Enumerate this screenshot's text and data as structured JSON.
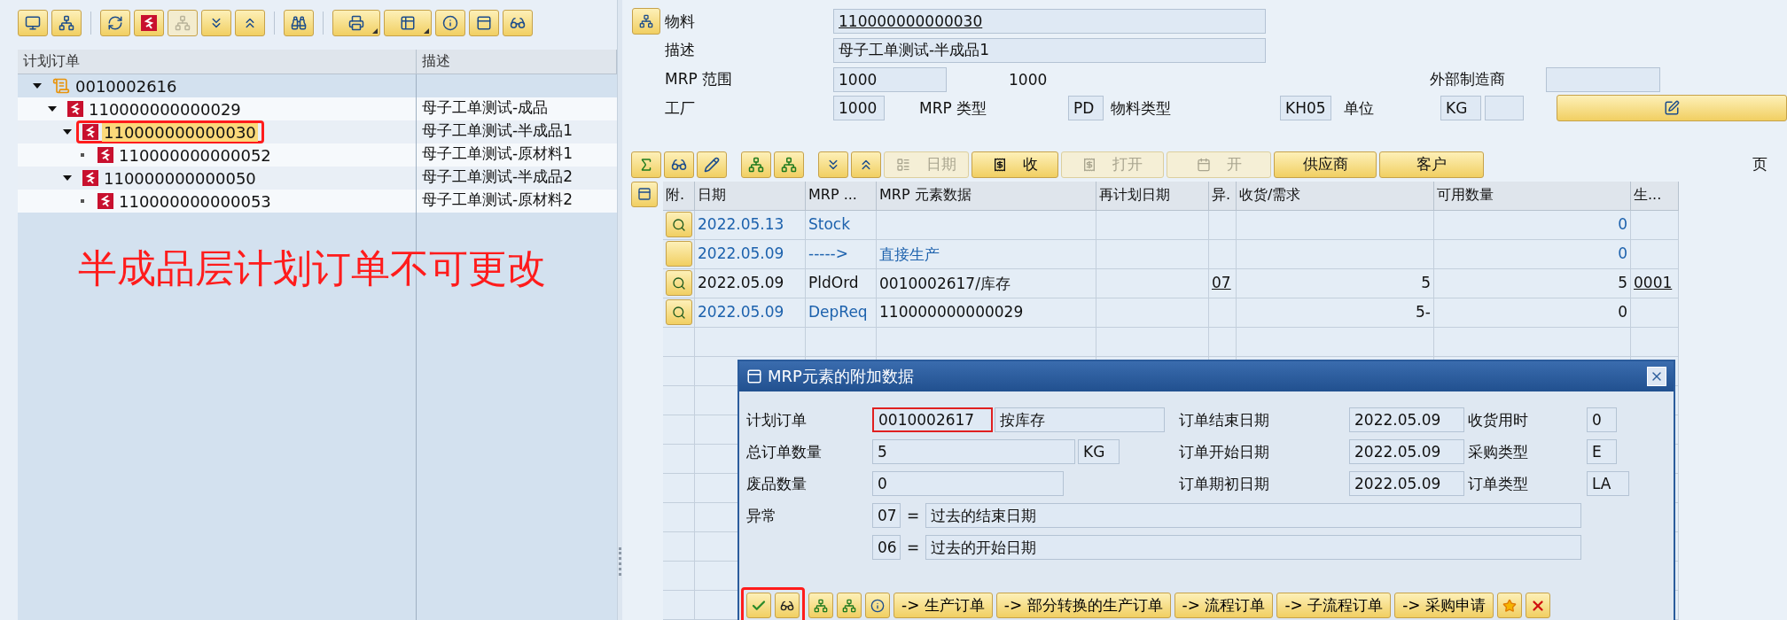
{
  "tree": {
    "columns": [
      "计划订单",
      "描述"
    ],
    "nodes": [
      {
        "label": "0010002616",
        "kind": "collective",
        "expanded": true,
        "selected": false,
        "marked": false,
        "children": [
          {
            "label": "110000000000029",
            "description": "母子工单测试-成品",
            "kind": "order",
            "expanded": true,
            "selected": false,
            "marked": false,
            "children": [
              {
                "label": "110000000000030",
                "description": "母子工单测试-半成品1",
                "kind": "order",
                "expanded": true,
                "selected": true,
                "marked": true,
                "children": [
                  {
                    "label": "110000000000052",
                    "description": "母子工单测试-原材料1",
                    "kind": "order",
                    "selected": false,
                    "marked": false
                  }
                ]
              },
              {
                "label": "110000000000050",
                "description": "母子工单测试-半成品2",
                "kind": "order",
                "expanded": true,
                "selected": false,
                "marked": false,
                "children": [
                  {
                    "label": "110000000000053",
                    "description": "母子工单测试-原材料2",
                    "kind": "order",
                    "selected": false,
                    "marked": false
                  }
                ]
              }
            ]
          }
        ]
      }
    ]
  },
  "annotation": {
    "text": "半成品层计划订单不可更改"
  },
  "header": {
    "material": {
      "label": "物料",
      "value": "110000000000030"
    },
    "description": {
      "label": "描述",
      "value": "母子工单测试-半成品1"
    },
    "mrp_area": {
      "label": "MRP 范围",
      "value": "1000",
      "text": "1000"
    },
    "manufacturer": {
      "label": "外部制造商"
    },
    "plant": {
      "label": "工厂",
      "value": "1000"
    },
    "mrp_type": {
      "label": "MRP 类型",
      "value": "PD"
    },
    "material_type": {
      "label": "物料类型",
      "value": "KH05"
    },
    "unit": {
      "label": "单位",
      "value": "KG"
    }
  },
  "toolbar": {
    "buttons": [
      {
        "label": "日期",
        "kind": "date",
        "disabled": true
      },
      {
        "label": "收",
        "kind": "receipt",
        "disabled": false
      },
      {
        "label": "打开",
        "kind": "receipt",
        "disabled": true
      },
      {
        "label": "开",
        "kind": "calendar",
        "disabled": true
      },
      {
        "label": "供应商",
        "kind": "text",
        "disabled": false
      },
      {
        "label": "客户",
        "kind": "text",
        "disabled": false
      }
    ],
    "page_label": "页"
  },
  "table": {
    "columns": [
      {
        "label": "附.",
        "kind": "icon"
      },
      {
        "label": "日期",
        "kind": "text"
      },
      {
        "label": "MRP ...",
        "kind": "text"
      },
      {
        "label": "MRP 元素数据",
        "kind": "text"
      },
      {
        "label": "再计划日期",
        "kind": "text"
      },
      {
        "label": "异.",
        "kind": "link"
      },
      {
        "label": "收货/需求",
        "kind": "number"
      },
      {
        "label": "可用数量",
        "kind": "number"
      },
      {
        "label": "生...",
        "kind": "link"
      }
    ],
    "rows": [
      {
        "kind": "info",
        "has_details": true,
        "cells": [
          "",
          "2022.05.13",
          "Stock",
          "",
          "",
          "",
          "",
          "0",
          ""
        ]
      },
      {
        "kind": "info",
        "has_details": false,
        "cells": [
          "",
          "2022.05.09",
          "----->",
          "直接生产",
          "",
          "",
          "",
          "0",
          ""
        ]
      },
      {
        "kind": "order",
        "has_details": true,
        "cells": [
          "",
          "2022.05.09",
          "PldOrd",
          "0010002617/库存",
          "",
          "07",
          "5",
          "5",
          "0001"
        ]
      },
      {
        "kind": "requirement",
        "has_details": true,
        "cells": [
          "",
          "2022.05.09",
          "DepReq",
          "110000000000029",
          "",
          "",
          "5-",
          "0",
          ""
        ]
      }
    ]
  },
  "dialog": {
    "title": "MRP元素的附加数据",
    "left_fields": [
      {
        "label": "计划订单",
        "value": "0010002617",
        "extra": "按库存",
        "focused": true
      },
      {
        "label": "总订单数量",
        "value": "5",
        "unit": "KG",
        "focused": false
      },
      {
        "label": "废品数量",
        "value": "0",
        "focused": false
      }
    ],
    "right_fields": [
      {
        "label": "订单结束日期",
        "value": "2022.05.09",
        "label2": "收货用时",
        "value2": "0"
      },
      {
        "label": "订单开始日期",
        "value": "2022.05.09",
        "label2": "采购类型",
        "value2": "E"
      },
      {
        "label": "订单期初日期",
        "value": "2022.05.09",
        "label2": "订单类型",
        "value2": "LA"
      }
    ],
    "exceptions": {
      "label": "异常",
      "items": [
        {
          "code": "07",
          "separator": "=",
          "text": "过去的结束日期"
        },
        {
          "code": "06",
          "separator": "=",
          "text": "过去的开始日期"
        }
      ]
    },
    "icon_buttons_marked": true,
    "buttons": [
      "-> 生产订单",
      "-> 部分转换的生产订单",
      "-> 流程订单",
      "-> 子流程订单",
      "-> 采购申请"
    ]
  }
}
